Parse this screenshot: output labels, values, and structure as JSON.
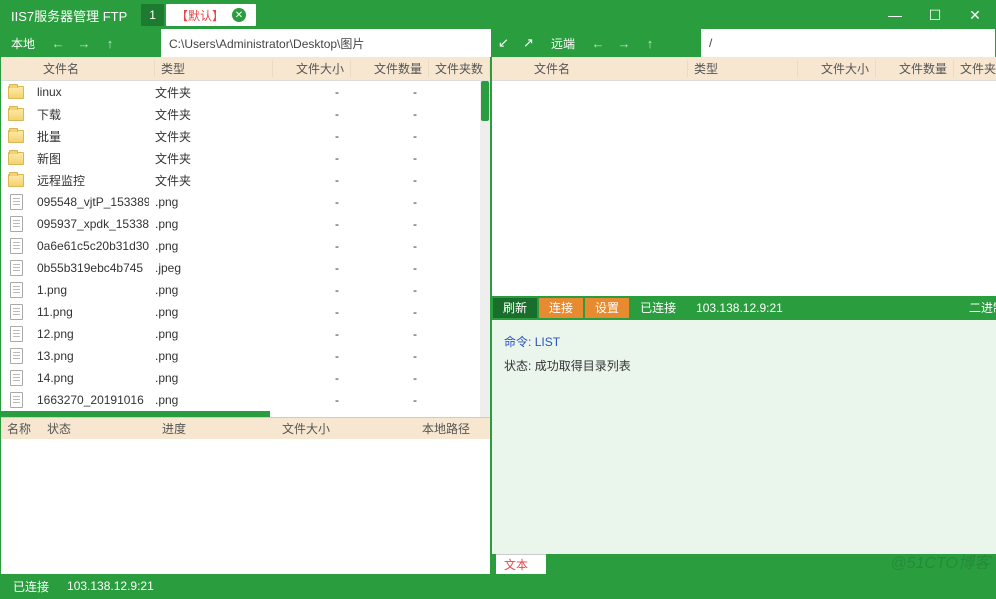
{
  "title": "IIS7服务器管理  FTP",
  "tabs": {
    "num": "1",
    "default": "【默认】"
  },
  "nav": {
    "local_label": "本地",
    "remote_label": "远端",
    "local_path": "C:\\Users\\Administrator\\Desktop\\图片",
    "remote_path": "/"
  },
  "columns": {
    "name": "文件名",
    "type": "类型",
    "size": "文件大小",
    "count": "文件数量",
    "ftime": "文件夹数"
  },
  "folder_type": "文件夹",
  "local_files": [
    {
      "icon": "folder",
      "name": "linux",
      "type": "文件夹",
      "size": "-",
      "count": "-",
      "ftime": "-"
    },
    {
      "icon": "folder",
      "name": "下载",
      "type": "文件夹",
      "size": "-",
      "count": "-",
      "ftime": "-"
    },
    {
      "icon": "folder",
      "name": "批量",
      "type": "文件夹",
      "size": "-",
      "count": "-",
      "ftime": "-"
    },
    {
      "icon": "folder",
      "name": "新图",
      "type": "文件夹",
      "size": "-",
      "count": "-",
      "ftime": "-"
    },
    {
      "icon": "folder",
      "name": "远程监控",
      "type": "文件夹",
      "size": "-",
      "count": "-",
      "ftime": "-"
    },
    {
      "icon": "file",
      "name": "095548_vjtP_153389",
      "type": ".png",
      "size": "-",
      "count": "-",
      "ftime": "-"
    },
    {
      "icon": "file",
      "name": "095937_xpdk_15338",
      "type": ".png",
      "size": "-",
      "count": "-",
      "ftime": "-"
    },
    {
      "icon": "file",
      "name": "0a6e61c5c20b31d30",
      "type": ".png",
      "size": "-",
      "count": "-",
      "ftime": "-"
    },
    {
      "icon": "file",
      "name": "0b55b319ebc4b745",
      "type": ".jpeg",
      "size": "-",
      "count": "-",
      "ftime": "-"
    },
    {
      "icon": "file",
      "name": "1.png",
      "type": ".png",
      "size": "-",
      "count": "-",
      "ftime": "-"
    },
    {
      "icon": "file",
      "name": "11.png",
      "type": ".png",
      "size": "-",
      "count": "-",
      "ftime": "-"
    },
    {
      "icon": "file",
      "name": "12.png",
      "type": ".png",
      "size": "-",
      "count": "-",
      "ftime": "-"
    },
    {
      "icon": "file",
      "name": "13.png",
      "type": ".png",
      "size": "-",
      "count": "-",
      "ftime": "-"
    },
    {
      "icon": "file",
      "name": "14.png",
      "type": ".png",
      "size": "-",
      "count": "-",
      "ftime": "-"
    },
    {
      "icon": "file",
      "name": "1663270_20191016",
      "type": ".png",
      "size": "-",
      "count": "-",
      "ftime": "-"
    }
  ],
  "xfer_cols": {
    "name": "名称",
    "status": "状态",
    "progress": "进度",
    "size": "文件大小",
    "path": "本地路径"
  },
  "btnbar": {
    "refresh": "刷新",
    "connect": "连接",
    "settings": "设置",
    "state": "已连接",
    "addr": "103.138.12.9:21",
    "mode": "二进制"
  },
  "log": {
    "cmd_label": "命令:",
    "cmd": "LIST",
    "state_label": "状态:",
    "state": "成功取得目录列表"
  },
  "text_tab": "文本",
  "status": {
    "state": "已连接",
    "addr": "103.138.12.9:21"
  },
  "watermark": "@51CTO博客"
}
